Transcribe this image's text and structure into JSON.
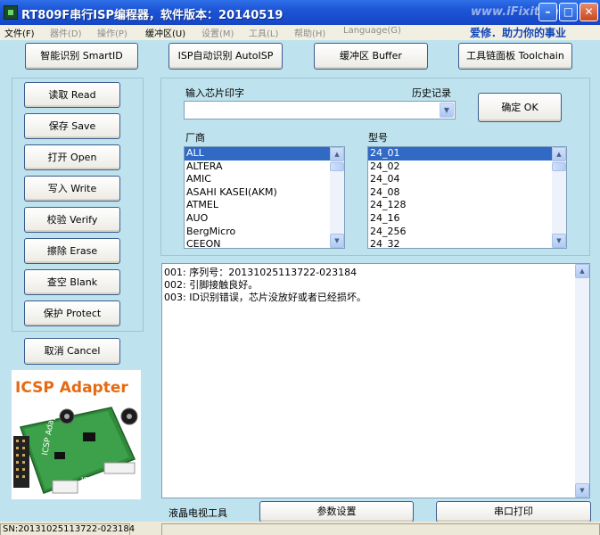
{
  "window": {
    "title": "RT809F串行ISP编程器，软件版本：20140519",
    "watermark": "www.iFixit.cn"
  },
  "menu": {
    "items": [
      {
        "label": "文件(F)",
        "enabled": true
      },
      {
        "label": "器件(D)",
        "enabled": false
      },
      {
        "label": "操作(P)",
        "enabled": false
      },
      {
        "label": "缓冲区(U)",
        "enabled": true
      },
      {
        "label": "设置(M)",
        "enabled": false
      },
      {
        "label": "工具(L)",
        "enabled": false
      },
      {
        "label": "帮助(H)",
        "enabled": false
      },
      {
        "label": "Language(G)",
        "enabled": false
      }
    ],
    "slogan": "爱修．助力你的事业"
  },
  "toolbar": {
    "smartid": "智能识别 SmartID",
    "autoisp": "ISP自动识别 AutoISP",
    "buffer": "缓冲区 Buffer",
    "toolchain": "工具链面板 Toolchain"
  },
  "ops": {
    "read": "读取 Read",
    "save": "保存 Save",
    "open": "打开 Open",
    "write": "写入 Write",
    "verify": "校验 Verify",
    "erase": "擦除 Erase",
    "blank": "查空 Blank",
    "protect": "保护 Protect",
    "cancel": "取消 Cancel"
  },
  "chip": {
    "input_label": "输入芯片印字",
    "history_label": "历史记录",
    "input_value": "",
    "ok_button": "确定 OK"
  },
  "vendor": {
    "label": "厂商",
    "items": [
      "ALL",
      "ALTERA",
      "AMIC",
      "ASAHI KASEI(AKM)",
      "ATMEL",
      "AUO",
      "BergMicro",
      "CEEON"
    ],
    "selected": 0
  },
  "model": {
    "label": "型号",
    "items": [
      "24_01",
      "24_02",
      "24_04",
      "24_08",
      "24_128",
      "24_16",
      "24_256",
      "24_32"
    ],
    "selected": 0
  },
  "log": {
    "lines": [
      "001: 序列号：20131025113722-023184",
      "002: 引脚接触良好。",
      "003: ID识别错误，芯片没放好或者已经损坏。"
    ]
  },
  "adapter": {
    "title": "ICSP Adapter",
    "board_text": "ICSP Adapter"
  },
  "bottom": {
    "lcd_label": "液晶电视工具",
    "params_button": "参数设置",
    "serial_button": "串口打印"
  },
  "status": {
    "sn": "SN:20131025113722-023184"
  },
  "colors": {
    "titlebar": "#1c55d6",
    "background": "#bfe3ee",
    "selection": "#316ac5",
    "brand_orange": "#e56a12",
    "slogan_blue": "#1245b8"
  },
  "icons": {
    "app": "chip-icon",
    "minimize": "minimize-icon",
    "maximize": "maximize-icon",
    "close": "close-icon",
    "dropdown": "chevron-down-icon",
    "scroll_up": "arrow-up-icon",
    "scroll_down": "arrow-down-icon"
  }
}
